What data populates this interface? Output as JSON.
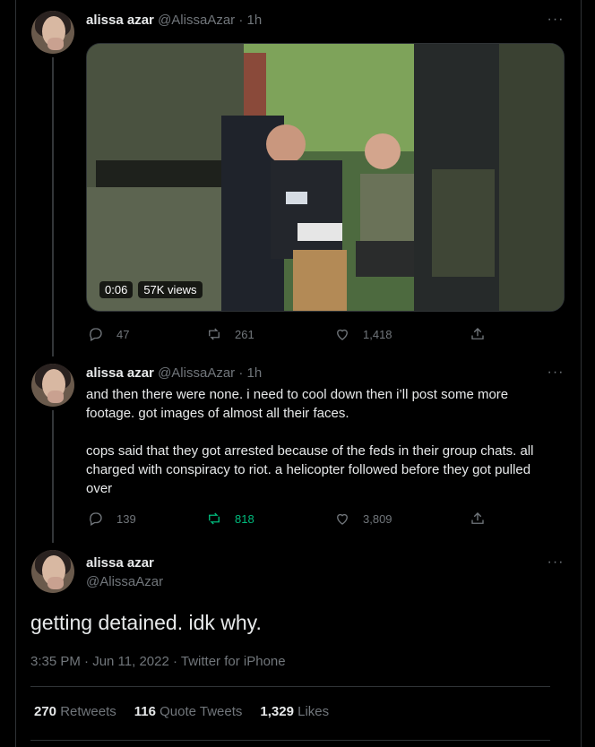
{
  "tweets": [
    {
      "name": "alissa azar",
      "handle": "@AlissaAzar",
      "time": "· 1h",
      "media": {
        "duration": "0:06",
        "views": "57K views"
      },
      "replies": "47",
      "retweets": "261",
      "likes": "1,418"
    },
    {
      "name": "alissa azar",
      "handle": "@AlissaAzar",
      "time": "· 1h",
      "text": "and then there were none. i need to cool down then i’ll post some more footage. got images of almost all their faces.\n\ncops said that they got arrested because of the feds in their group chats. all charged with conspiracy to riot. a helicopter followed before they got pulled over",
      "replies": "139",
      "retweets": "818",
      "likes": "3,809"
    }
  ],
  "main_tweet": {
    "name": "alissa azar",
    "handle": "@AlissaAzar",
    "text": "getting detained. idk why.",
    "meta": "3:35 PM · Jun 11, 2022 · Twitter for iPhone",
    "stats": {
      "retweets_count": "270",
      "retweets_label": "Retweets",
      "quotes_count": "116",
      "quotes_label": "Quote Tweets",
      "likes_count": "1,329",
      "likes_label": "Likes"
    }
  },
  "colors": {
    "background": "#000000",
    "text": "#e7e9ea",
    "muted": "#71767b",
    "retweet_active": "#00ba7c",
    "border": "#2f3336"
  },
  "icons": [
    "more-icon",
    "reply-icon",
    "retweet-icon",
    "like-icon",
    "share-icon"
  ]
}
